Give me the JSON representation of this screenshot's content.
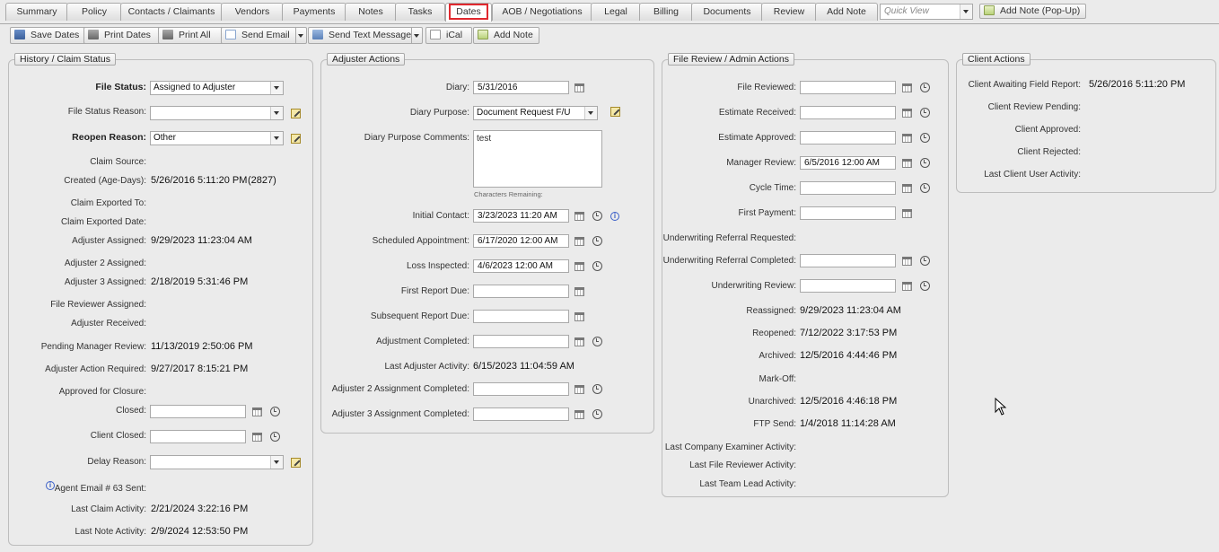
{
  "tabs": [
    "Summary",
    "Policy",
    "Contacts / Claimants",
    "Vendors",
    "Payments",
    "Notes",
    "Tasks",
    "Dates",
    "AOB / Negotiations",
    "Legal",
    "Billing",
    "Documents",
    "Review",
    "Add Note"
  ],
  "quick_view_placeholder": "Quick View",
  "add_note_popup_label": "Add Note (Pop-Up)",
  "toolbar": {
    "save_dates": "Save Dates",
    "print_dates": "Print Dates",
    "print_all": "Print All",
    "send_email": "Send Email",
    "send_text": "Send Text Message",
    "ical": "iCal",
    "add_note": "Add Note"
  },
  "history": {
    "legend": "History / Claim Status",
    "file_status_label": "File Status:",
    "file_status_value": "Assigned to Adjuster",
    "file_status_reason_label": "File Status Reason:",
    "reopen_reason_label": "Reopen Reason:",
    "reopen_reason_value": "Other",
    "claim_source_label": "Claim Source:",
    "created_label": "Created (Age-Days):",
    "created_value": "5/26/2016 5:11:20 PM",
    "created_age": "(2827)",
    "claim_exported_to_label": "Claim Exported To:",
    "claim_exported_date_label": "Claim Exported Date:",
    "adjuster_assigned_label": "Adjuster Assigned:",
    "adjuster_assigned_value": "9/29/2023 11:23:04 AM",
    "adjuster2_assigned_label": "Adjuster 2 Assigned:",
    "adjuster3_assigned_label": "Adjuster 3 Assigned:",
    "adjuster3_assigned_value": "2/18/2019 5:31:46 PM",
    "file_reviewer_assigned_label": "File Reviewer Assigned:",
    "adjuster_received_label": "Adjuster Received:",
    "pending_manager_review_label": "Pending Manager Review:",
    "pending_manager_review_value": "11/13/2019 2:50:06 PM",
    "adjuster_action_required_label": "Adjuster Action Required:",
    "adjuster_action_required_value": "9/27/2017 8:15:21 PM",
    "approved_for_closure_label": "Approved for Closure:",
    "closed_label": "Closed:",
    "client_closed_label": "Client Closed:",
    "delay_reason_label": "Delay Reason:",
    "agent_email_label": "Agent Email # 63 Sent:",
    "last_claim_activity_label": "Last Claim Activity:",
    "last_claim_activity_value": "2/21/2024 3:22:16 PM",
    "last_note_activity_label": "Last Note Activity:",
    "last_note_activity_value": "2/9/2024 12:53:50 PM"
  },
  "adjuster": {
    "legend": "Adjuster Actions",
    "diary_label": "Diary:",
    "diary_value": "5/31/2016",
    "diary_purpose_label": "Diary Purpose:",
    "diary_purpose_value": "Document Request F/U",
    "diary_comments_label": "Diary Purpose Comments:",
    "diary_comments_value": "test",
    "chars_remaining": "Characters Remaining:",
    "initial_contact_label": "Initial Contact:",
    "initial_contact_value": "3/23/2023 11:20 AM",
    "scheduled_appointment_label": "Scheduled Appointment:",
    "scheduled_appointment_value": "6/17/2020 12:00 AM",
    "loss_inspected_label": "Loss Inspected:",
    "loss_inspected_value": "4/6/2023 12:00 AM",
    "first_report_due_label": "First Report Due:",
    "subsequent_report_due_label": "Subsequent Report Due:",
    "adjustment_completed_label": "Adjustment Completed:",
    "last_adjuster_activity_label": "Last Adjuster Activity:",
    "last_adjuster_activity_value": "6/15/2023 11:04:59 AM",
    "adj2_completed_label": "Adjuster 2 Assignment Completed:",
    "adj3_completed_label": "Adjuster 3 Assignment Completed:"
  },
  "review": {
    "legend": "File Review / Admin Actions",
    "file_reviewed_label": "File Reviewed:",
    "estimate_received_label": "Estimate Received:",
    "estimate_approved_label": "Estimate Approved:",
    "manager_review_label": "Manager Review:",
    "manager_review_value": "6/5/2016 12:00 AM",
    "cycle_time_label": "Cycle Time:",
    "first_payment_label": "First Payment:",
    "uw_referral_requested_label": "Underwriting Referral Requested:",
    "uw_referral_completed_label": "Underwriting Referral Completed:",
    "uw_review_label": "Underwriting Review:",
    "reassigned_label": "Reassigned:",
    "reassigned_value": "9/29/2023 11:23:04 AM",
    "reopened_label": "Reopened:",
    "reopened_value": "7/12/2022 3:17:53 PM",
    "archived_label": "Archived:",
    "archived_value": "12/5/2016 4:44:46 PM",
    "mark_off_label": "Mark-Off:",
    "unarchived_label": "Unarchived:",
    "unarchived_value": "12/5/2016 4:46:18 PM",
    "ftp_send_label": "FTP Send:",
    "ftp_send_value": "1/4/2018 11:14:28 AM",
    "last_company_examiner_label": "Last Company Examiner Activity:",
    "last_file_reviewer_label": "Last File Reviewer Activity:",
    "last_team_lead_label": "Last Team Lead Activity:"
  },
  "client": {
    "legend": "Client Actions",
    "awaiting_field_report_label": "Client Awaiting Field Report:",
    "awaiting_field_report_value": "5/26/2016 5:11:20 PM",
    "review_pending_label": "Client Review Pending:",
    "approved_label": "Client Approved:",
    "rejected_label": "Client Rejected:",
    "last_user_activity_label": "Last Client User Activity:"
  }
}
